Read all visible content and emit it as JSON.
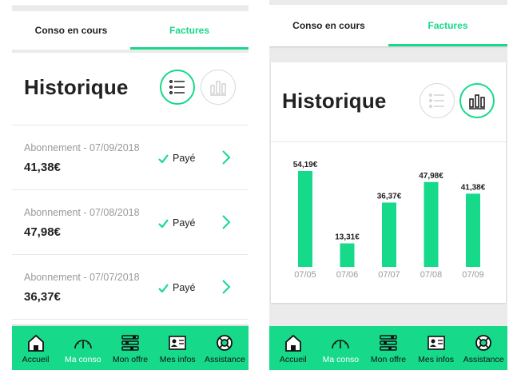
{
  "tabs": [
    {
      "label": "Conso en cours",
      "active": false
    },
    {
      "label": "Factures",
      "active": true
    }
  ],
  "history": {
    "title": "Historique"
  },
  "view_toggle": {
    "list_icon": "list-icon",
    "chart_icon": "bar-chart-icon"
  },
  "invoices": [
    {
      "label": "Abonnement - 07/09/2018",
      "amount": "41,38€",
      "status": "Payé"
    },
    {
      "label": "Abonnement - 07/08/2018",
      "amount": "47,98€",
      "status": "Payé"
    },
    {
      "label": "Abonnement - 07/07/2018",
      "amount": "36,37€",
      "status": "Payé"
    }
  ],
  "nav": [
    {
      "label": "Accueil",
      "icon": "home-icon",
      "active": false
    },
    {
      "label": "Ma conso",
      "icon": "gauge-icon",
      "active": true
    },
    {
      "label": "Mon offre",
      "icon": "sliders-icon",
      "active": false
    },
    {
      "label": "Mes infos",
      "icon": "id-card-icon",
      "active": false
    },
    {
      "label": "Assistance",
      "icon": "lifebuoy-icon",
      "active": false
    }
  ],
  "colors": {
    "accent": "#16d98a",
    "text": "#222222",
    "muted": "#9a9a9a"
  },
  "chart_data": {
    "type": "bar",
    "categories": [
      "07/05",
      "07/06",
      "07/07",
      "07/08",
      "07/09"
    ],
    "values": [
      54.19,
      13.31,
      36.37,
      47.98,
      41.38
    ],
    "value_labels": [
      "54,19€",
      "13,31€",
      "36,37€",
      "47,98€",
      "41,38€"
    ],
    "title": "",
    "xlabel": "",
    "ylabel": "",
    "ylim": [
      0,
      54.19
    ],
    "grid": false,
    "color": "#16d98a"
  }
}
